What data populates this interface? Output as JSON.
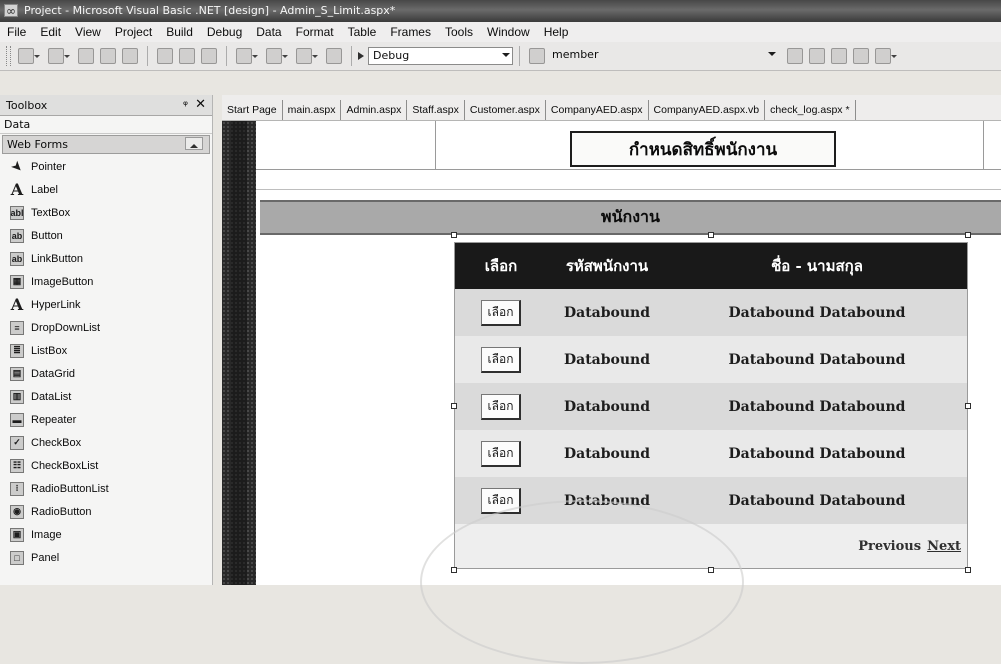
{
  "window": {
    "title": "Project - Microsoft Visual Basic .NET [design] - Admin_S_Limit.aspx*"
  },
  "menu": [
    "File",
    "Edit",
    "View",
    "Project",
    "Build",
    "Debug",
    "Data",
    "Format",
    "Table",
    "Frames",
    "Tools",
    "Window",
    "Help"
  ],
  "toolbar": {
    "config_label": "Debug",
    "project_label": "member"
  },
  "toolbox": {
    "title": "Toolbox",
    "pin_glyph": "ᵠ",
    "close_glyph": "✕",
    "sections": {
      "data": "Data",
      "web_forms": "Web Forms"
    },
    "items": [
      {
        "label": "Pointer",
        "icon": "pointer-icon",
        "glyph": ""
      },
      {
        "label": "Label",
        "icon": "label-icon",
        "glyph": "A"
      },
      {
        "label": "TextBox",
        "icon": "textbox-icon",
        "glyph": "abl"
      },
      {
        "label": "Button",
        "icon": "button-icon",
        "glyph": "ab"
      },
      {
        "label": "LinkButton",
        "icon": "linkbutton-icon",
        "glyph": "ab"
      },
      {
        "label": "ImageButton",
        "icon": "imagebutton-icon",
        "glyph": "▦"
      },
      {
        "label": "HyperLink",
        "icon": "hyperlink-icon",
        "glyph": "A"
      },
      {
        "label": "DropDownList",
        "icon": "dropdownlist-icon",
        "glyph": "≡"
      },
      {
        "label": "ListBox",
        "icon": "listbox-icon",
        "glyph": "≣"
      },
      {
        "label": "DataGrid",
        "icon": "datagrid-icon",
        "glyph": "▤"
      },
      {
        "label": "DataList",
        "icon": "datalist-icon",
        "glyph": "▥"
      },
      {
        "label": "Repeater",
        "icon": "repeater-icon",
        "glyph": "▬"
      },
      {
        "label": "CheckBox",
        "icon": "checkbox-icon",
        "glyph": "✓"
      },
      {
        "label": "CheckBoxList",
        "icon": "checkboxlist-icon",
        "glyph": "☷"
      },
      {
        "label": "RadioButtonList",
        "icon": "radiobuttonlist-icon",
        "glyph": "⁝"
      },
      {
        "label": "RadioButton",
        "icon": "radiobutton-icon",
        "glyph": "◉"
      },
      {
        "label": "Image",
        "icon": "image-icon",
        "glyph": "▣"
      },
      {
        "label": "Panel",
        "icon": "panel-icon",
        "glyph": "□"
      }
    ]
  },
  "tabs": [
    "Start Page",
    "main.aspx",
    "Admin.aspx",
    "Staff.aspx",
    "Customer.aspx",
    "CompanyAED.aspx",
    "CompanyAED.aspx.vb",
    "check_log.aspx *"
  ],
  "design": {
    "page_title": "กำหนดสิทธิ์พนักงาน",
    "section_title": "พนักงาน",
    "grid": {
      "headers": {
        "select": "เลือก",
        "id": "รหัสพนักงาน",
        "name": "ชื่อ - นามสกุล"
      },
      "rows": [
        {
          "button": "เลือก",
          "id": "Databound",
          "name": "Databound Databound"
        },
        {
          "button": "เลือก",
          "id": "Databound",
          "name": "Databound Databound"
        },
        {
          "button": "เลือก",
          "id": "Databound",
          "name": "Databound Databound"
        },
        {
          "button": "เลือก",
          "id": "Databound",
          "name": "Databound Databound"
        },
        {
          "button": "เลือก",
          "id": "Databound",
          "name": "Databound Databound"
        }
      ],
      "pager": {
        "previous": "Previous",
        "next": "Next"
      }
    }
  }
}
